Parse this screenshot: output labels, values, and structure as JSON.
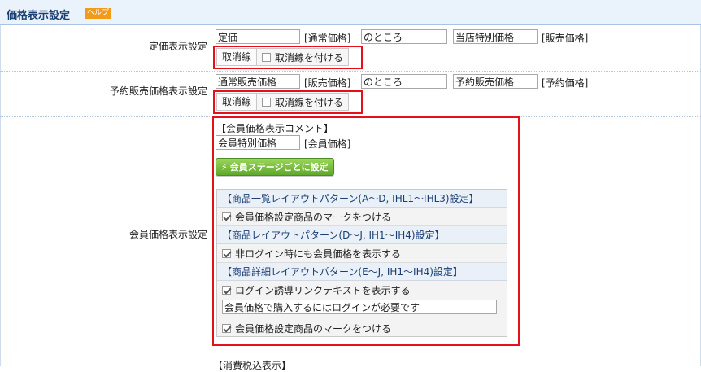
{
  "header": {
    "title": "価格表示設定",
    "help_label": "ヘルプ"
  },
  "list_price": {
    "label": "定価表示設定",
    "field1": "定価",
    "tag1": "[通常価格]",
    "middle": "のところ",
    "field2": "当店特別価格",
    "tag2": "[販売価格]",
    "strike_label": "取消線",
    "strike_check_label": "取消線を付ける"
  },
  "reserve_price": {
    "label": "予約販売価格表示設定",
    "field1": "通常販売価格",
    "tag1": "[販売価格]",
    "middle": "のところ",
    "field2": "予約販売価格",
    "tag2": "[予約価格]",
    "strike_label": "取消線",
    "strike_check_label": "取消線を付ける"
  },
  "member_price": {
    "label": "会員価格表示設定",
    "comment_heading": "【会員価格表示コメント】",
    "comment_field": "会員特別価格",
    "comment_tag": "[会員価格]",
    "stage_button": "会員ステージごとに設定",
    "panel": {
      "section1_heading": "【商品一覧レイアウトパターン(A〜D, IHL1〜IHL3)設定】",
      "section1_check": "会員価格設定商品のマークをつける",
      "section2_heading": "【商品レイアウトパターン(D〜J, IH1〜IH4)設定】",
      "section2_check": "非ログイン時にも会員価格を表示する",
      "section3_heading": "【商品詳細レイアウトパターン(E〜J, IH1〜IH4)設定】",
      "section3_check1": "ログイン誘導リンクテキストを表示する",
      "section3_text_value": "会員価格で購入するにはログインが必要です",
      "section3_check2": "会員価格設定商品のマークをつける"
    }
  },
  "tax_section": {
    "heading": "【消費税込表示】"
  }
}
